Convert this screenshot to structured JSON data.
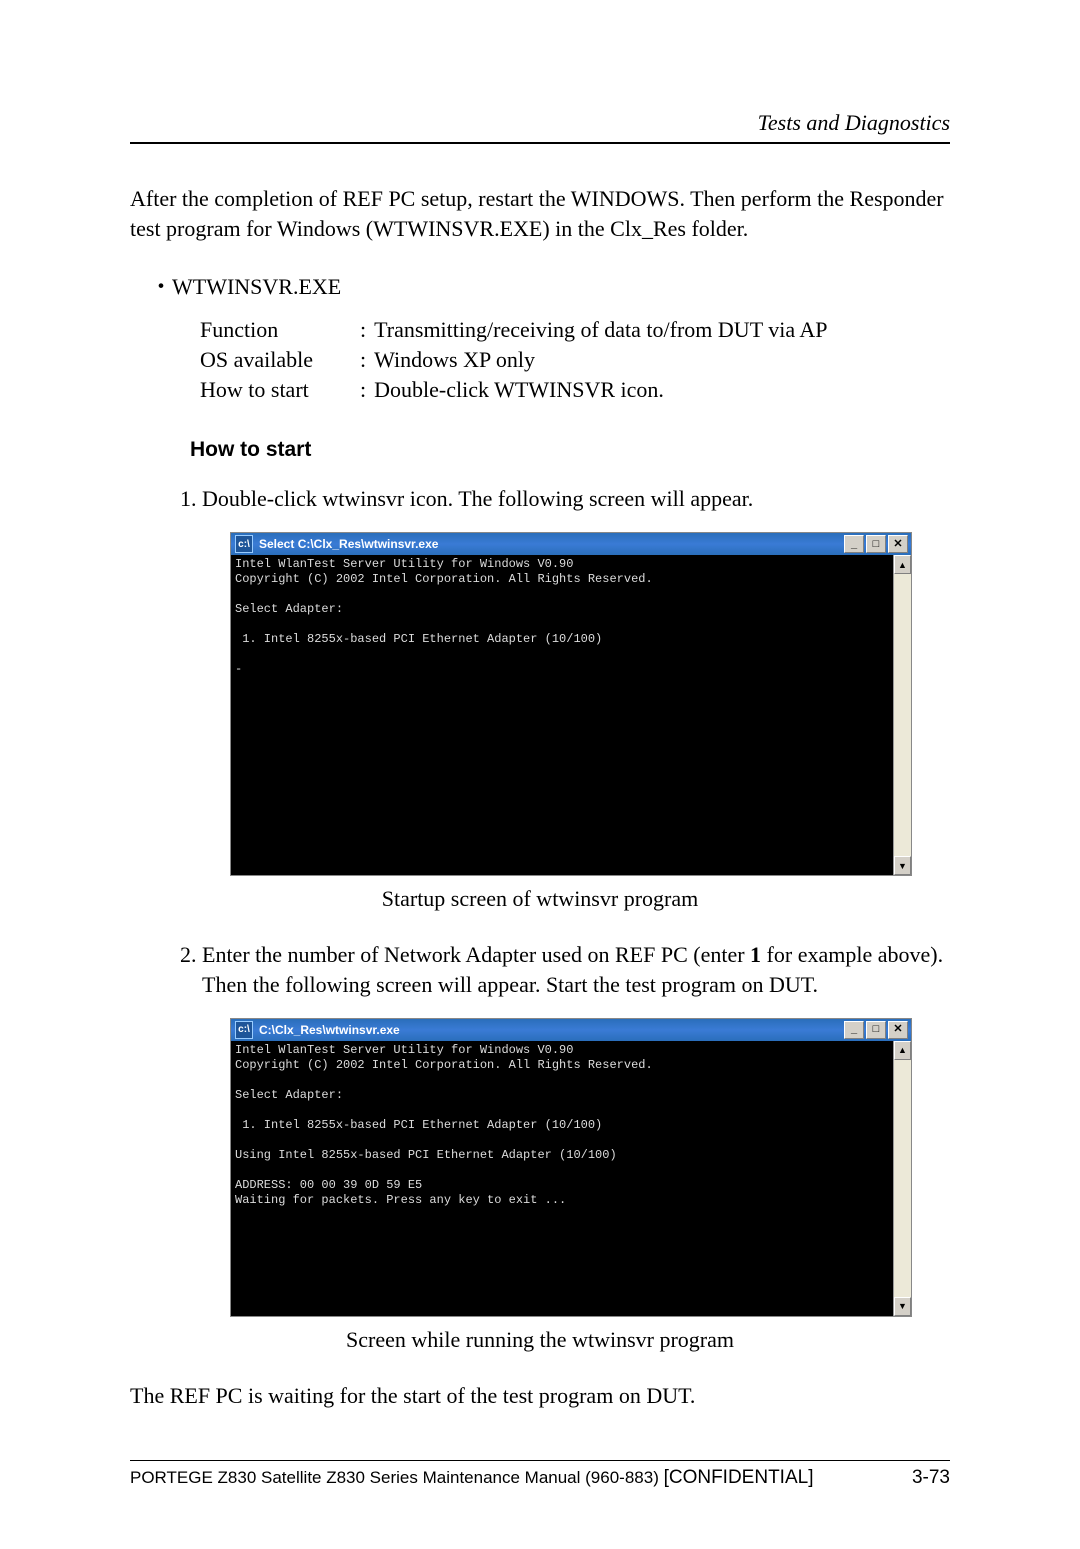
{
  "header": {
    "section": "Tests and Diagnostics"
  },
  "intro": "After the completion of REF PC setup, restart the WINDOWS. Then perform the Responder test program for Windows (WTWINSVR.EXE) in the Clx_Res folder.",
  "bullet": "・WTWINSVR.EXE",
  "specs": {
    "function_label": "Function",
    "function_value": "Transmitting/receiving of data to/from DUT via AP",
    "os_label": "OS available",
    "os_value": "Windows XP only",
    "start_label": "How to start",
    "start_value": "Double-click WTWINSVR icon."
  },
  "heading_howto": "How to start",
  "step1": "1. Double-click wtwinsvr icon. The following screen will appear.",
  "window1": {
    "title": "Select C:\\Clx_Res\\wtwinsvr.exe",
    "lines": "Intel WlanTest Server Utility for Windows V0.90\nCopyright (C) 2002 Intel Corporation. All Rights Reserved.\n\nSelect Adapter:\n\n 1. Intel 8255x-based PCI Ethernet Adapter (10/100)\n\n-"
  },
  "caption1": "Startup screen of wtwinsvr program",
  "step2_a": "2. Enter the number of Network Adapter used on REF PC (enter ",
  "step2_bold": "1",
  "step2_b": " for example above). Then the following screen will appear. Start the test program on DUT.",
  "window2": {
    "title": "C:\\Clx_Res\\wtwinsvr.exe",
    "lines": "Intel WlanTest Server Utility for Windows V0.90\nCopyright (C) 2002 Intel Corporation. All Rights Reserved.\n\nSelect Adapter:\n\n 1. Intel 8255x-based PCI Ethernet Adapter (10/100)\n\nUsing Intel 8255x-based PCI Ethernet Adapter (10/100)\n\nADDRESS: 00 00 39 0D 59 E5\nWaiting for packets. Press any key to exit ..."
  },
  "caption2": "Screen while running the wtwinsvr program",
  "closing": "The REF PC is waiting for the start of the test program on DUT.",
  "footer": {
    "manual": "PORTEGE Z830 Satellite Z830 Series Maintenance Manual (960-883) ",
    "confidential": "[CONFIDENTIAL]",
    "page": "3-73"
  },
  "winbtn": {
    "min": "_",
    "max": "□",
    "close": "✕",
    "up": "▲",
    "down": "▼"
  }
}
